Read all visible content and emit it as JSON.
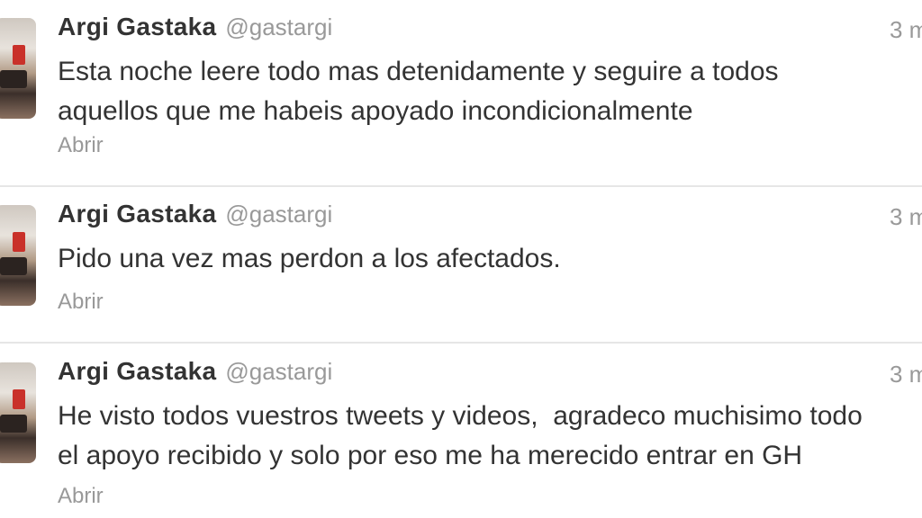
{
  "tweets": [
    {
      "name": "Argi Gastaka",
      "handle": "@gastargi",
      "time": "3 m",
      "text": "Esta noche leere todo mas detenidamente y seguire a todos\naquellos que me habeis apoyado incondicionalmente",
      "action": "Abrir"
    },
    {
      "name": "Argi Gastaka",
      "handle": "@gastargi",
      "time": "3 m",
      "text": "Pido una vez mas perdon a los afectados.",
      "action": "Abrir"
    },
    {
      "name": "Argi Gastaka",
      "handle": "@gastargi",
      "time": "3 m",
      "text": "He visto todos vuestros tweets y videos,  agradeco muchisimo todo\nel apoyo recibido y solo por eso me ha merecido entrar en GH",
      "action": "Abrir"
    }
  ]
}
